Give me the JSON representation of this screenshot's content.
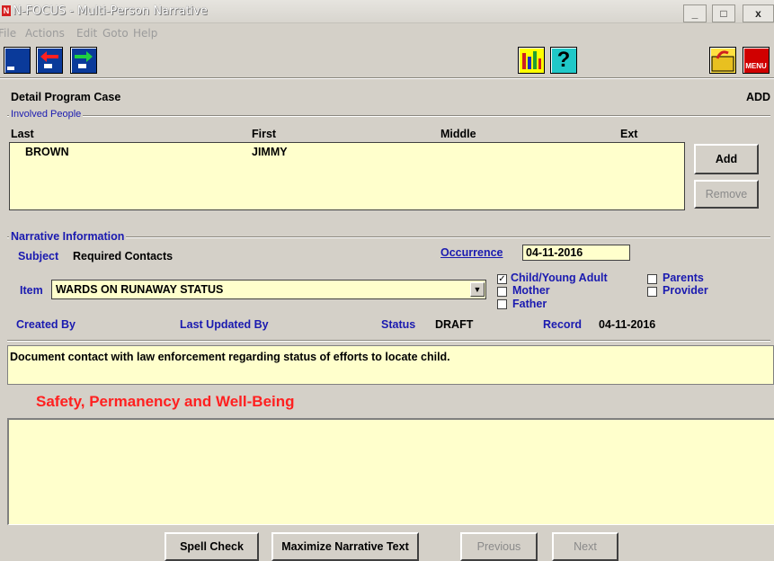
{
  "window": {
    "title": "N-FOCUS - Multi-Person Narrative",
    "app_icon_glyph": "N",
    "minimize": "_",
    "maximize": "□",
    "close": "x"
  },
  "menu": [
    "File",
    "Actions",
    "Edit",
    "Goto",
    "Help"
  ],
  "toolbar": {
    "icons": [
      "new-window-icon",
      "back-arrow-icon",
      "forward-arrow-icon",
      "chart-icon",
      "help-icon",
      "return-folder-icon",
      "menu-icon"
    ],
    "help_glyph": "?",
    "menu_glyph": "MENU"
  },
  "header": {
    "title": "Detail Program Case",
    "mode": "ADD"
  },
  "involved_people": {
    "group_label": "Involved People",
    "columns": [
      "Last",
      "First",
      "Middle",
      "Ext"
    ],
    "rows": [
      {
        "last": "BROWN",
        "first": "JIMMY",
        "middle": "",
        "ext": ""
      }
    ],
    "add_label": "Add",
    "remove_label": "Remove"
  },
  "narrative": {
    "group_label": "Narrative Information",
    "subject_label": "Subject",
    "subject_value": "Required Contacts",
    "occurrence_label": "Occurrence",
    "occurrence_value": "04-11-2016",
    "item_label": "Item",
    "item_value": "WARDS ON RUNAWAY STATUS",
    "checkboxes": [
      {
        "label": "Child/Young Adult",
        "checked": true
      },
      {
        "label": "Mother",
        "checked": false
      },
      {
        "label": "Father",
        "checked": false
      },
      {
        "label": "Parents",
        "checked": false
      },
      {
        "label": "Provider",
        "checked": false
      }
    ],
    "created_by_label": "Created By",
    "last_updated_label": "Last Updated By",
    "status_label": "Status",
    "status_value": "DRAFT",
    "record_label": "Record",
    "record_value": "04-11-2016"
  },
  "instruction_text": "Document contact with law enforcement regarding status of efforts to locate child.",
  "section_heading": "Safety, Permanency and Well-Being",
  "colors": {
    "heading_red": "#ff2020",
    "field_yellow": "#ffffcc",
    "window_gray": "#d4d0c8",
    "toolbar_blue": "#0a3a9a"
  },
  "buttons": {
    "spell_check": "Spell Check",
    "maximize": "Maximize Narrative Text",
    "previous": "Previous",
    "next": "Next"
  }
}
